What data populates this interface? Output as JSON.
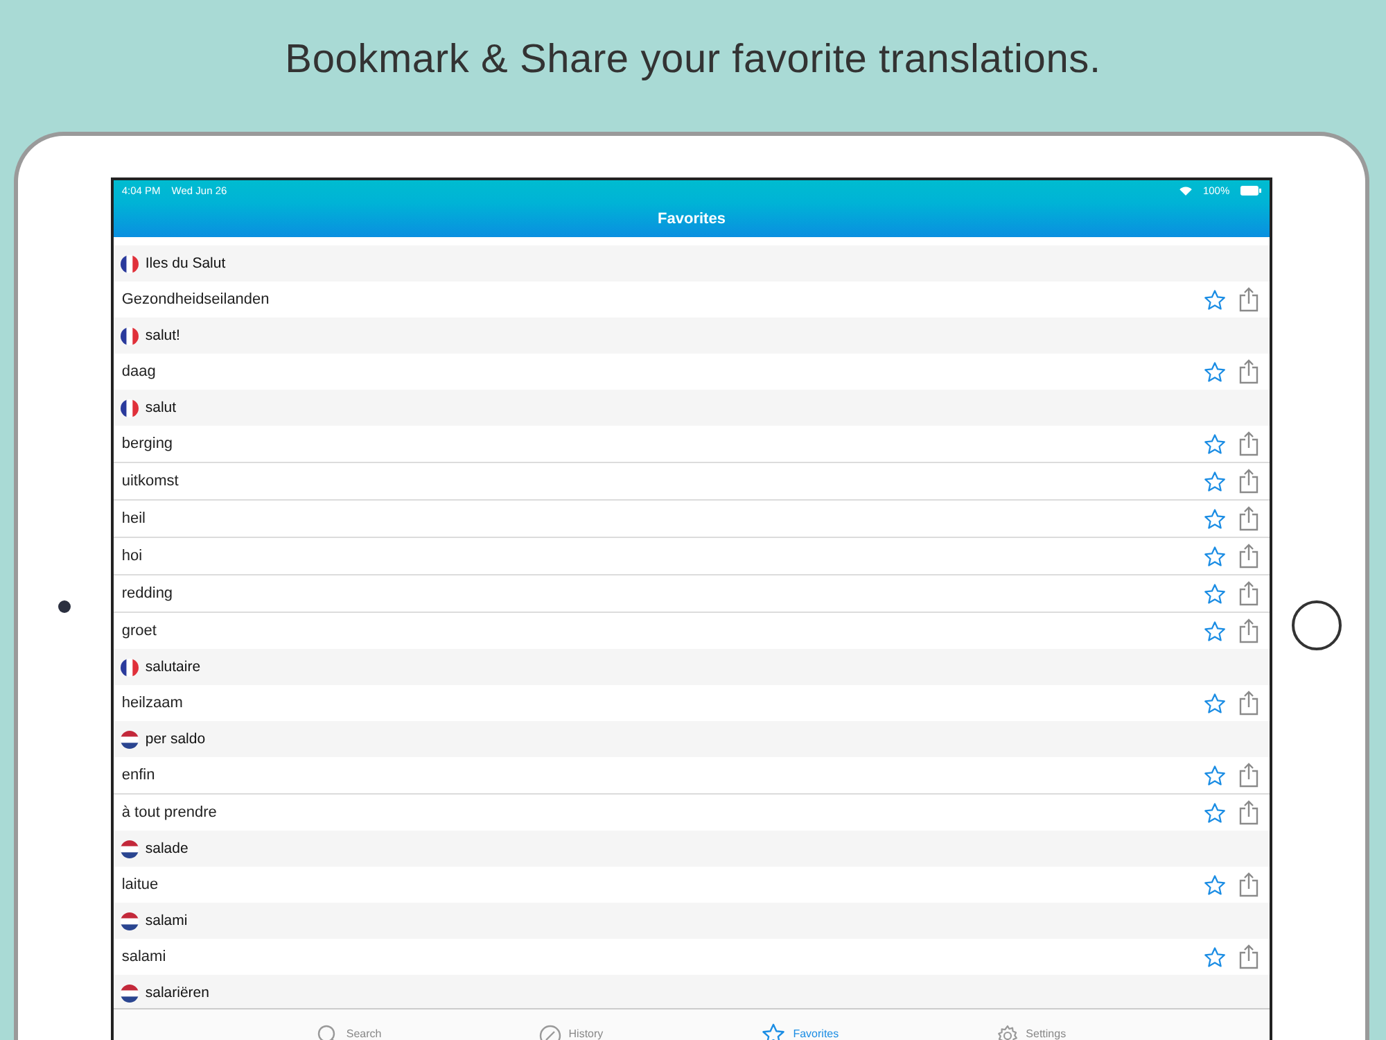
{
  "headline": "Bookmark & Share your favorite translations.",
  "status_bar": {
    "time": "4:04 PM",
    "date": "Wed Jun 26",
    "battery": "100%"
  },
  "nav_bar": {
    "title": "Favorites"
  },
  "groups": [
    {
      "kind": "fr",
      "term": "Iles du Salut",
      "translations": [
        "Gezondheidseilanden"
      ]
    },
    {
      "kind": "fr",
      "term": "salut!",
      "translations": [
        "daag"
      ]
    },
    {
      "kind": "fr",
      "term": "salut",
      "translations": [
        "berging",
        "uitkomst",
        "heil",
        "hoi",
        "redding",
        "groet"
      ]
    },
    {
      "kind": "fr",
      "term": "salutaire",
      "translations": [
        "heilzaam"
      ]
    },
    {
      "kind": "nl",
      "term": "per saldo",
      "translations": [
        "enfin",
        "à tout prendre"
      ]
    },
    {
      "kind": "nl",
      "term": "salade",
      "translations": [
        "laitue"
      ]
    },
    {
      "kind": "nl",
      "term": "salami",
      "translations": [
        "salami"
      ]
    },
    {
      "kind": "nl",
      "term": "salariëren"
    }
  ],
  "tabs": [
    {
      "kind": "search",
      "label": "Search",
      "selected": false
    },
    {
      "kind": "history",
      "label": "History",
      "selected": false
    },
    {
      "kind": "favorites",
      "label": "Favorites",
      "selected": true
    },
    {
      "kind": "settings",
      "label": "Settings",
      "selected": false
    }
  ]
}
